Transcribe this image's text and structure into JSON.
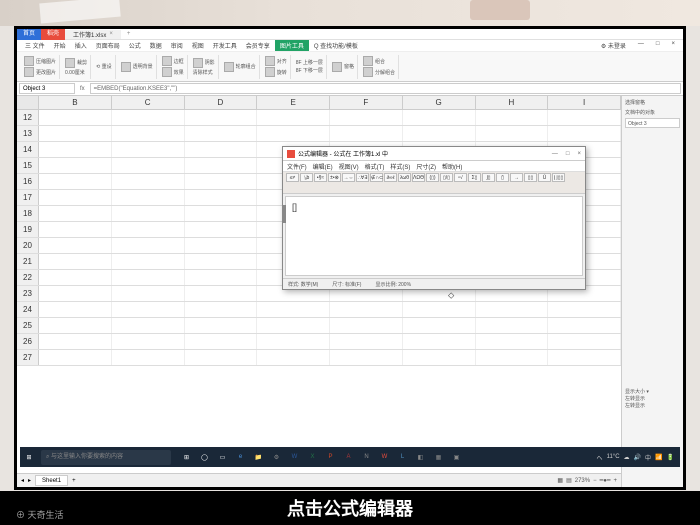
{
  "titlebar": {
    "home": "首页",
    "doc": "稻壳",
    "tab": "工作簿1.xlsx",
    "plus": "+"
  },
  "menu": {
    "items": [
      "三 文件",
      "开始",
      "插入",
      "页面布局",
      "公式",
      "数据",
      "审阅",
      "视图",
      "开发工具",
      "会员专享"
    ],
    "active": "图片工具",
    "after": [
      "Q 查找功能/模板"
    ],
    "right": [
      "⚙ 未登录",
      "—",
      "□",
      "×"
    ]
  },
  "ribbon": {
    "groups": [
      "压缩图片",
      "更改图片",
      "裁剪",
      "0.00厘米",
      "⟲ 重设",
      "透明背景",
      "边框",
      "效果",
      "阴影",
      "清除样式",
      "轮廓组合",
      "对齐",
      "旋转",
      "8F 上移一层",
      "8F 下移一层",
      "窗格",
      "组合",
      "分解组合"
    ]
  },
  "formula": {
    "name": "Object 3",
    "fx": "=EMBED(\"Equation.KSEE3\",\"\")"
  },
  "cols": [
    "B",
    "C",
    "D",
    "E",
    "F",
    "G",
    "H",
    "I"
  ],
  "rows": [
    12,
    13,
    14,
    15,
    16,
    17,
    18,
    19,
    20,
    21,
    22,
    23,
    24,
    25,
    26,
    27
  ],
  "sidepanel": {
    "title": "选择窗格",
    "sub": "文档中的对象",
    "obj": "Object 3",
    "bottom": [
      "显示大小 ▾",
      "左转显示",
      "左转显示"
    ]
  },
  "sheettab": "Sheet1",
  "status": {
    "zoom": "273%",
    "temp": "11°C"
  },
  "eq": {
    "title": "公式编辑器 - 公式在 工作簿1.xl 中",
    "menu": [
      "文件(F)",
      "编辑(E)",
      "视图(V)",
      "格式(T)",
      "样式(S)",
      "尺寸(Z)",
      "帮助(H)"
    ],
    "tools": [
      "≤≠",
      "ⁱₐb",
      "•§≈",
      "±•⊗",
      "→⇔",
      "∴∀∃",
      "∉∩⊂",
      "∂∞ℓ",
      "λωθ",
      "ΛΩΘ",
      "(▯)",
      "▯/▯",
      "ⁿ√",
      "Σ▯",
      "∫▯",
      "▯̄",
      "→",
      "▯▯",
      "Ū",
      "⌊⌋▯▯"
    ],
    "body": "[]",
    "status": [
      "样式: 数学(M)",
      "尺寸: 标准(F)",
      "显示比例: 200%"
    ]
  },
  "taskbar": {
    "search": "与这里输入你要搜索的内容",
    "icons": [
      "⊞",
      "◯",
      "▭",
      "e",
      "📁",
      "⚙",
      "W",
      "X",
      "P",
      "A",
      "N",
      "W",
      "L",
      "◧",
      "▦",
      "▣"
    ],
    "tray": [
      "へ",
      "☁",
      "🔊",
      "中",
      "📶",
      "🔋"
    ]
  },
  "caption": "点击公式编辑器",
  "watermark": "⊕ 天奇生活"
}
